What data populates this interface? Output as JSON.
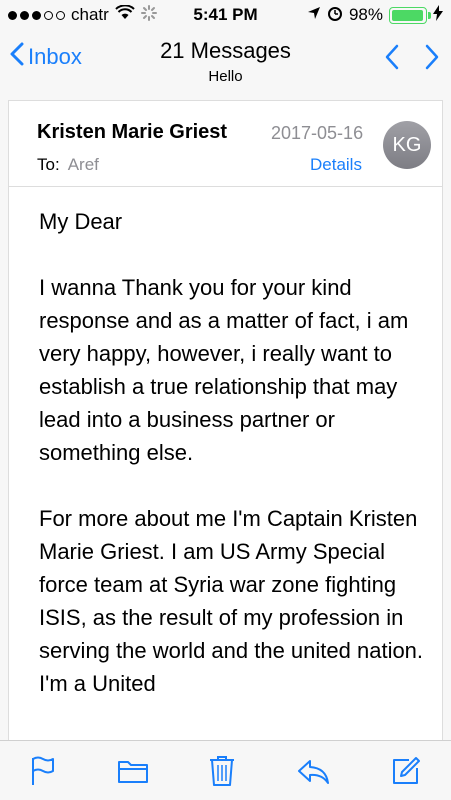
{
  "status_bar": {
    "carrier": "chatr",
    "time": "5:41 PM",
    "battery": "98%",
    "battery_level": 0.98,
    "signal_bars_filled": 3,
    "signal_bars_total": 5
  },
  "nav": {
    "back_label": "Inbox",
    "title": "21 Messages",
    "subtitle": "Hello"
  },
  "message": {
    "sender": "Kristen Marie Griest",
    "date": "2017-05-16",
    "to_label": "To:",
    "to_name": "Aref",
    "details_label": "Details",
    "avatar_initials": "KG",
    "paragraphs": [
      "My Dear",
      "I wanna Thank you for your kind response and as a matter of fact, i am very happy, however, i really want to establish a true relationship that may lead into a business partner or something else.",
      "For more about me I'm Captain Kristen Marie Griest. I am US Army Special force team at Syria war zone fighting ISIS, as the result of my profession in serving the world and the united nation. I'm a United"
    ]
  },
  "toolbar": {
    "icons": [
      "flag-icon",
      "folder-icon",
      "trash-icon",
      "reply-icon",
      "compose-icon"
    ]
  },
  "colors": {
    "accent": "#1a7ffb",
    "battery": "#4cd964",
    "secondary_text": "#8e8e93"
  }
}
